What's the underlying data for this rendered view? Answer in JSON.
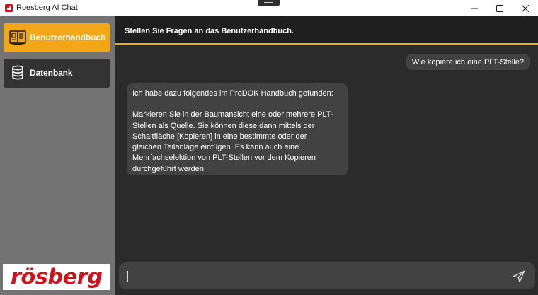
{
  "window": {
    "title": "Roesberg AI Chat"
  },
  "sidebar": {
    "items": [
      {
        "label": "Benutzerhandbuch",
        "icon": "book-icon",
        "active": true
      },
      {
        "label": "Datenbank",
        "icon": "database-icon",
        "active": false
      }
    ],
    "logo_text": "rösberg"
  },
  "header": {
    "title": "Stellen Sie Fragen an das Benutzerhandbuch."
  },
  "chat": {
    "user_message": "Wie kopiere ich eine PLT-Stelle?",
    "bot_message": {
      "intro": "Ich habe dazu folgendes im ProDOK Handbuch gefunden:",
      "lines": [
        "Markieren Sie in der Baumansicht eine oder mehrere PLT-",
        "Stellen als Quelle. Sie können diese dann mittels der",
        "Schaltfläche [Kopieren] in eine bestimmte oder der",
        "gleichen Teilanlage einfügen. Es kann auch eine",
        "Mehrfachselektion von PLT-Stellen vor dem Kopieren",
        "durchgeführt werden."
      ]
    }
  },
  "input": {
    "value": "",
    "placeholder": ""
  },
  "colors": {
    "accent": "#f2a719",
    "sidebar_bg": "#737373",
    "main_bg": "#2b2b2b",
    "header_bg": "#1f1f1f",
    "bubble_bg": "#424242",
    "logo_red": "#d0111b"
  }
}
